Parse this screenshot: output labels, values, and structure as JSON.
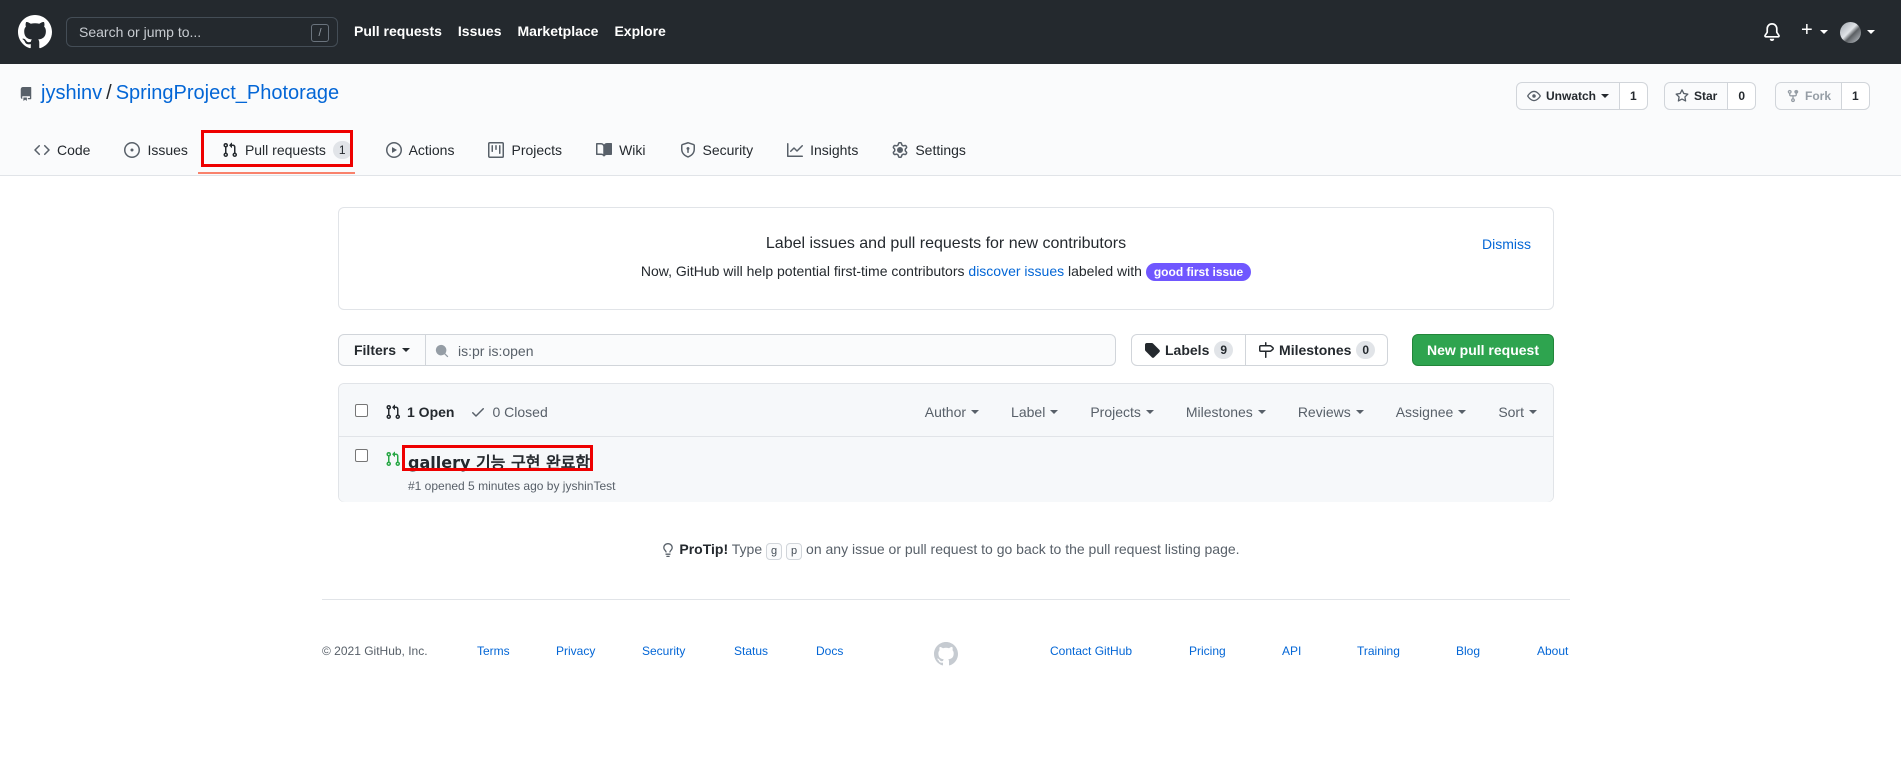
{
  "header": {
    "search_placeholder": "Search or jump to...",
    "search_key": "/",
    "nav": [
      "Pull requests",
      "Issues",
      "Marketplace",
      "Explore"
    ]
  },
  "repo": {
    "owner": "jyshinv",
    "separator": "/",
    "name": "SpringProject_Photorage",
    "watch_label": "Unwatch",
    "watch_count": "1",
    "star_label": "Star",
    "star_count": "0",
    "fork_label": "Fork",
    "fork_count": "1"
  },
  "tabs": [
    {
      "label": "Code"
    },
    {
      "label": "Issues"
    },
    {
      "label": "Pull requests",
      "count": "1"
    },
    {
      "label": "Actions"
    },
    {
      "label": "Projects"
    },
    {
      "label": "Wiki"
    },
    {
      "label": "Security"
    },
    {
      "label": "Insights"
    },
    {
      "label": "Settings"
    }
  ],
  "banner": {
    "title": "Label issues and pull requests for new contributors",
    "text_before": "Now, GitHub will help potential first-time contributors",
    "link": "discover issues",
    "text_after": "labeled with",
    "label": "good first issue",
    "dismiss": "Dismiss"
  },
  "filters": {
    "button": "Filters",
    "query": "is:pr is:open"
  },
  "labels": {
    "label": "Labels",
    "count": "9"
  },
  "milestones": {
    "label": "Milestones",
    "count": "0"
  },
  "new_pr": "New pull request",
  "list": {
    "open": "1 Open",
    "closed": "0 Closed",
    "sorts": [
      "Author",
      "Label",
      "Projects",
      "Milestones",
      "Reviews",
      "Assignee",
      "Sort"
    ],
    "items": [
      {
        "title": "gallery 기능 구현 완료함",
        "meta": "#1 opened 5 minutes ago by jyshinTest"
      }
    ]
  },
  "protip": {
    "label": "ProTip!",
    "before": "Type",
    "k1": "g",
    "k2": "p",
    "after": "on any issue or pull request to go back to the pull request listing page."
  },
  "footer": {
    "copyright": "© 2021 GitHub, Inc.",
    "left_links": [
      "Terms",
      "Privacy",
      "Security",
      "Status",
      "Docs"
    ],
    "right_links": [
      "Contact GitHub",
      "Pricing",
      "API",
      "Training",
      "Blog",
      "About"
    ]
  },
  "colors": {
    "header_bg": "#24292e",
    "link": "#0366d6",
    "primary_button": "#2ea44f",
    "good_first_issue": "#7057ff",
    "tab_underline": "#f9826c",
    "pr_open": "#28a745",
    "highlight_box": "#ee0000"
  }
}
